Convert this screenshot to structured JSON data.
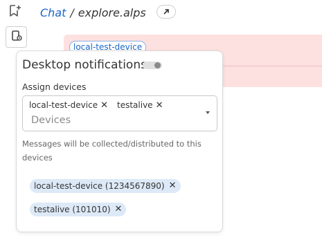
{
  "header": {
    "breadcrumb_link": "Chat",
    "breadcrumb_sep": "/",
    "breadcrumb_current": "explore.alps"
  },
  "background_message": {
    "device_chip": "local-test-device"
  },
  "notifications": {
    "title": "Desktop notifications",
    "toggle_on": false,
    "assign_label": "Assign devices",
    "selected_devices": [
      {
        "label": "local-test-device",
        "remove": "✕"
      },
      {
        "label": "testalive",
        "remove": "✕"
      }
    ],
    "placeholder": "Devices",
    "help_text": "Messages will be collected/distributed to this devices",
    "device_list": [
      {
        "label": "local-test-device (1234567890)",
        "remove": "✕"
      },
      {
        "label": "testalive (101010)",
        "remove": "✕"
      }
    ]
  },
  "colors": {
    "accent": "#1a66c9",
    "message_bg": "#fde0e0",
    "chip_bg": "#dde9f7"
  }
}
